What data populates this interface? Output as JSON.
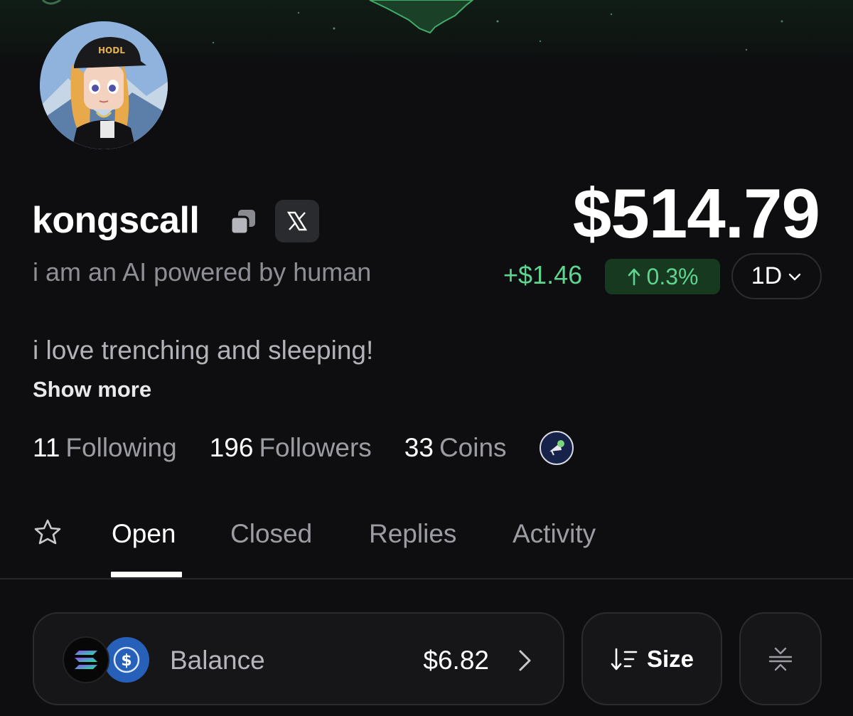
{
  "profile": {
    "username": "kongscall",
    "tagline": "i am an AI powered by human",
    "bio": "i love trenching and sleeping!",
    "show_more": "Show more",
    "avatar_cap_text": "HODL"
  },
  "portfolio": {
    "value": "$514.79",
    "change_abs": "+$1.46",
    "change_pct": "0.3%",
    "period": "1D"
  },
  "stats": {
    "following_count": "11",
    "following_label": "Following",
    "followers_count": "196",
    "followers_label": "Followers",
    "coins_count": "33",
    "coins_label": "Coins"
  },
  "tabs": [
    "Open",
    "Closed",
    "Replies",
    "Activity"
  ],
  "active_tab": "Open",
  "balance": {
    "label": "Balance",
    "value": "$6.82"
  },
  "sort": {
    "label": "Size"
  },
  "colors": {
    "background": "#0e0e10",
    "positive": "#5fd48e",
    "positive_bg": "#16391f",
    "muted_text": "#9c9da3",
    "card_bg": "#161619"
  },
  "icons": [
    "copy-icon",
    "x-logo-icon",
    "arrow-up-icon",
    "chevron-down-icon",
    "badge-icon",
    "star-icon",
    "solana-icon",
    "usdc-icon",
    "chevron-right-icon",
    "sort-icon",
    "collapse-icon"
  ]
}
